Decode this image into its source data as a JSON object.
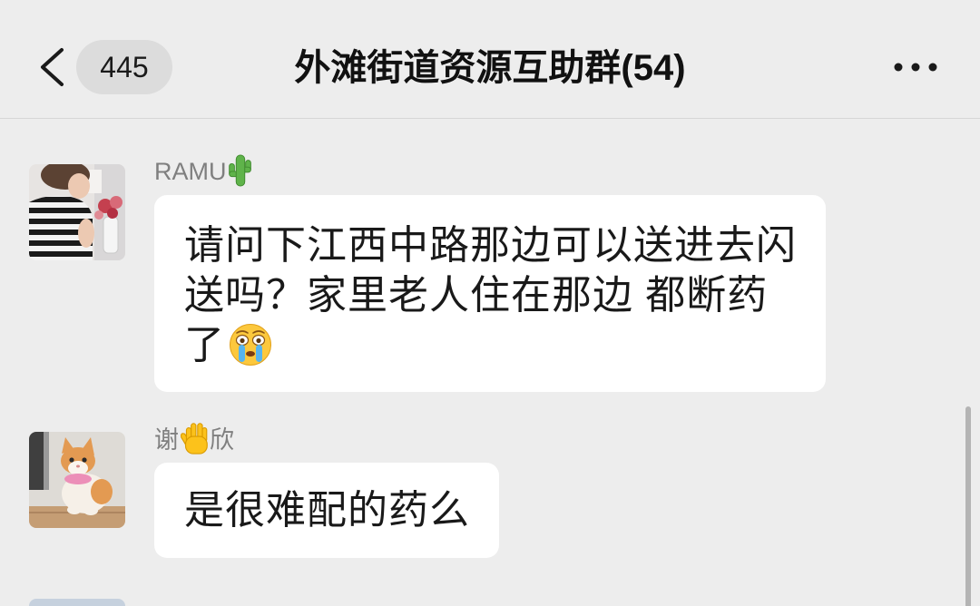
{
  "colors": {
    "background": "#ededed",
    "bubble": "#ffffff",
    "text": "#191919",
    "sender_name": "#7f7f7f",
    "badge_background": "#dcdcdc",
    "divider": "#d6d6d6",
    "scrollbar": "#b4b4b4"
  },
  "header": {
    "back_icon": "chevron-left-icon",
    "unread_count": "445",
    "title": "外滩街道资源互助群(54)",
    "more_icon": "more-dots-icon"
  },
  "messages": [
    {
      "avatar": "avatar-person-photo",
      "sender": {
        "name": "RAMU",
        "emoji": "cactus-icon"
      },
      "text": "请问下江西中路那边可以送进去闪送吗？家里老人住在那边 都断药了",
      "trailing_emoji": "crying-face-icon"
    },
    {
      "avatar": "avatar-cat-photo",
      "sender": {
        "name_before": "谢",
        "emoji": "vulcan-salute-icon",
        "name_after": "欣"
      },
      "text": "是很难配的药么"
    },
    {
      "avatar": "avatar-partial"
    }
  ]
}
